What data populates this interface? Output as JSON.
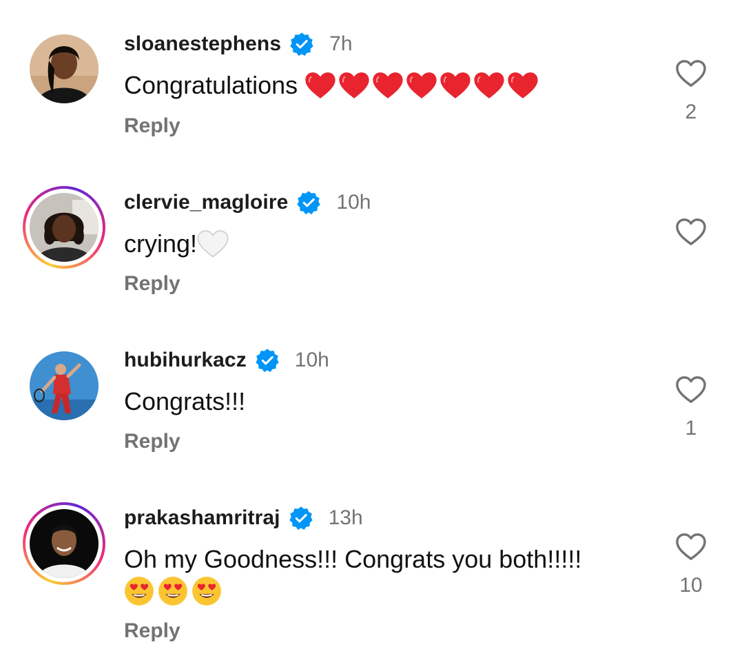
{
  "comments": [
    {
      "username": "sloanestephens",
      "time": "7h",
      "text": "Congratulations",
      "reply_label": "Reply",
      "likes": "2",
      "story_ring": false,
      "emojis": [
        "red-heart",
        "red-heart",
        "red-heart",
        "red-heart",
        "red-heart",
        "red-heart",
        "red-heart"
      ]
    },
    {
      "username": "clervie_magloire",
      "time": "10h",
      "text": "crying!",
      "reply_label": "Reply",
      "likes": "",
      "story_ring": true,
      "emojis": [
        "white-heart"
      ]
    },
    {
      "username": "hubihurkacz",
      "time": "10h",
      "text": "Congrats!!!",
      "reply_label": "Reply",
      "likes": "1",
      "story_ring": false,
      "emojis": []
    },
    {
      "username": "prakashamritraj",
      "time": "13h",
      "text": "Oh my Goodness!!! Congrats you both!!!!!",
      "reply_label": "Reply",
      "likes": "10",
      "story_ring": true,
      "emojis": [
        "heart-eyes-face",
        "heart-eyes-face",
        "heart-eyes-face"
      ]
    }
  ],
  "colors": {
    "verified_blue": "#0095f6",
    "muted_gray": "#737373",
    "heart_red": "#e8242f"
  }
}
